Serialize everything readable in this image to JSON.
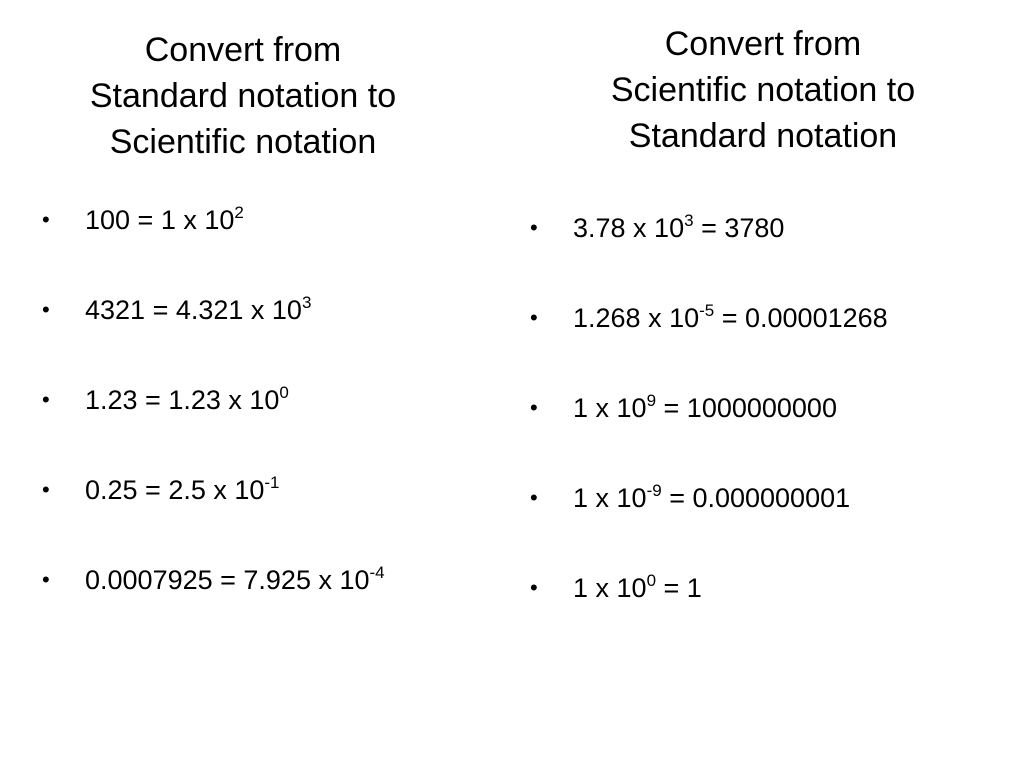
{
  "left_column": {
    "heading_lines": [
      "Convert from",
      "Standard notation to",
      "Scientific notation"
    ],
    "items": [
      {
        "pre": "100 = 1 x 10",
        "exp": "2",
        "post": ""
      },
      {
        "pre": "4321 = 4.321 x 10",
        "exp": "3",
        "post": ""
      },
      {
        "pre": "1.23 = 1.23 x 10",
        "exp": "0",
        "post": ""
      },
      {
        "pre": "0.25 = 2.5 x 10",
        "exp": "-1",
        "post": ""
      },
      {
        "pre": "0.0007925 = 7.925 x 10",
        "exp": "-4",
        "post": ""
      }
    ]
  },
  "right_column": {
    "heading_lines": [
      "Convert from",
      "Scientific notation to",
      "Standard notation"
    ],
    "items": [
      {
        "pre": "3.78 x 10",
        "exp": "3",
        "post": " = 3780"
      },
      {
        "pre": "1.268 x 10",
        "exp": "-5",
        "post": " = 0.00001268"
      },
      {
        "pre": "1 x 10",
        "exp": "9",
        "post": " = 1000000000"
      },
      {
        "pre": "1 x 10",
        "exp": "-9",
        "post": " = 0.000000001"
      },
      {
        "pre": "1 x 10",
        "exp": "0",
        "post": " = 1"
      }
    ]
  },
  "bullet_glyph": "•"
}
